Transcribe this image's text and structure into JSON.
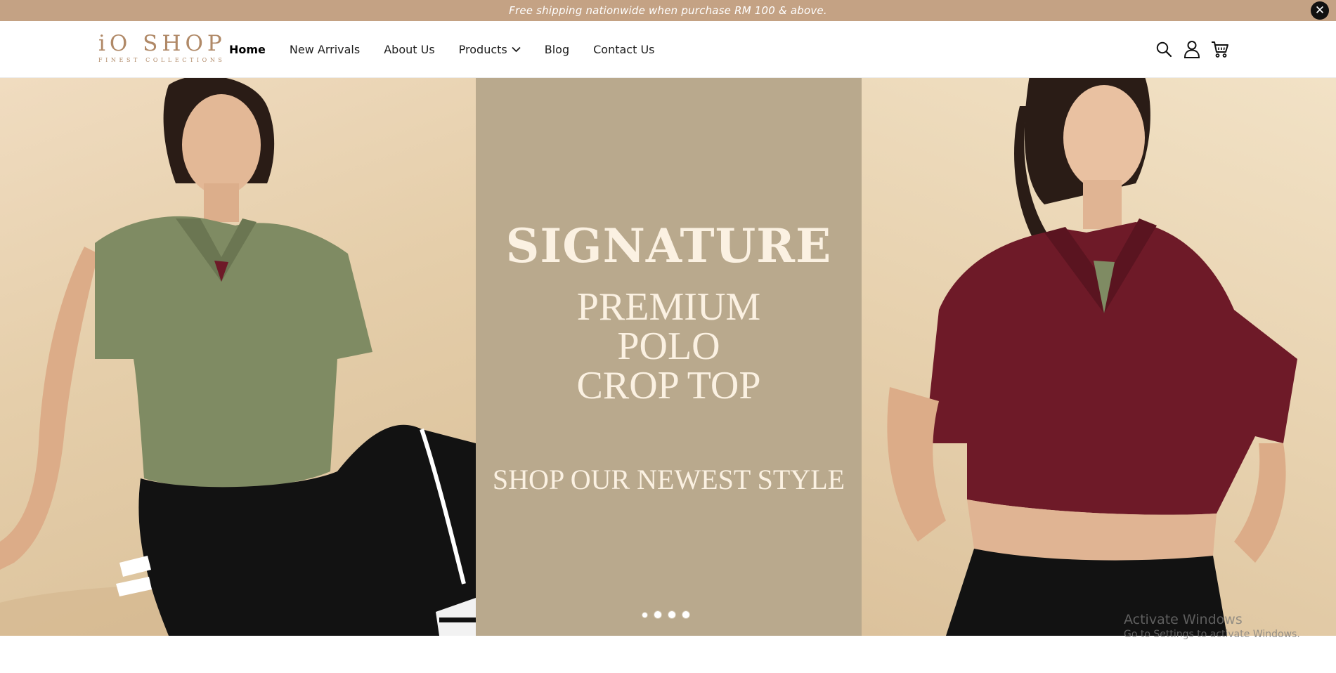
{
  "announcement": {
    "text": "Free shipping nationwide when purchase RM 100 & above.",
    "close_icon": "close-icon"
  },
  "logo": {
    "main": "iO SHOP",
    "tagline": "FINEST COLLECTIONS"
  },
  "nav": {
    "items": [
      {
        "label": "Home",
        "active": true
      },
      {
        "label": "New Arrivals",
        "active": false
      },
      {
        "label": "About Us",
        "active": false
      },
      {
        "label": "Products",
        "active": false,
        "has_dropdown": true
      },
      {
        "label": "Blog",
        "active": false
      },
      {
        "label": "Contact Us",
        "active": false
      }
    ]
  },
  "header_icons": [
    "search-icon",
    "user-icon",
    "cart-icon"
  ],
  "hero": {
    "headline": "SIGNATURE",
    "lines": [
      "PREMIUM",
      "POLO",
      "CROP TOP"
    ],
    "cta": "SHOP OUR NEWEST STYLE",
    "slide_count": 4,
    "active_slide": 1
  },
  "watermark": {
    "title": "Activate Windows",
    "subtitle": "Go to Settings to activate Windows."
  },
  "colors": {
    "announcement_bg": "#c4a284",
    "brand": "#b08967",
    "center_panel": "#b9a98d",
    "hero_text": "#fbf1e2",
    "olive_top": "#7f8b63",
    "burgundy_top": "#6e1a28"
  }
}
